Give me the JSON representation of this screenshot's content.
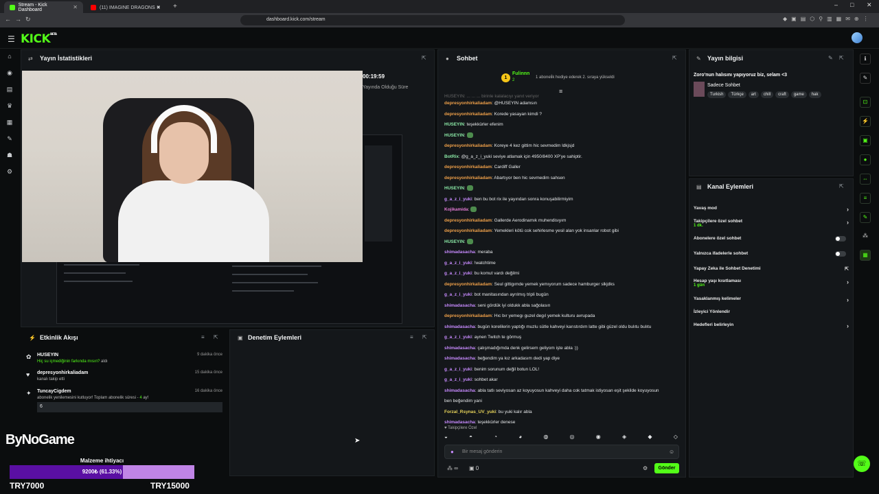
{
  "browser": {
    "tabs": [
      {
        "label": "Stream - Kick Dashboard",
        "active": true
      },
      {
        "label": "(11) IMAGINE DRAGONS ✖ Geo...",
        "active": false
      }
    ],
    "new_tab": "+",
    "url": "dashboard.kick.com/stream"
  },
  "header": {
    "logo": "KICK",
    "logo_badge": "BETA"
  },
  "stats": {
    "title": "Yayın İstatistikleri",
    "duration": "00:19:59",
    "duration_label": "Yayında Olduğu Süre"
  },
  "activity": {
    "title": "Etkinlik Akışı",
    "items": [
      {
        "name": "HUSEYIN",
        "message": "Hiç su içmediğinin farkında mısın?",
        "suffix": "aldı",
        "time": "9 dakika önce"
      },
      {
        "name": "depresyonhirkaliadam",
        "message": "kanalı takip etti",
        "suffix": "",
        "time": "15 dakika önce"
      },
      {
        "name": "TuncayCigdem",
        "message": "abonelik yenilemesini kutluyor! Toplam abonelik süresi -",
        "months": "4",
        "suffix": "ay!",
        "time": "16 dakika önce",
        "note": "6"
      }
    ]
  },
  "moderation": {
    "title": "Denetim Eylemleri"
  },
  "chat": {
    "title": "Sohbet",
    "pinned_user": "Fulinnn",
    "pinned_count": "2",
    "pinned_text": "1 aboneli̇k hediye ederek 2. sıraya yükseldi",
    "top_cut": "HUSEYIN: ... ... ... birinle kalalacıyı yanıt veriyor",
    "messages": [
      {
        "user": "depresyonhirkaliadam",
        "c": "u-or",
        "text": "@HUSEYIN adamsın"
      },
      {
        "user": "depresyonhirkaliadam",
        "c": "u-or",
        "text": "Korede yasayan kimdi ?"
      },
      {
        "user": "HUSEYIN",
        "c": "u-gr",
        "text": "teşekkürler efenim"
      },
      {
        "user": "HUSEYIN",
        "c": "u-gr",
        "text": "",
        "emote": true
      },
      {
        "user": "depresyonhirkaliadam",
        "c": "u-or",
        "text": "Koreye 4 kez gittim hic sevmedim ldkjsjd"
      },
      {
        "user": "BotRix",
        "c": "u-gr",
        "text": "@g_a_z_i_yuki seviye atlamak için 4950/8400 XP'ye sahiptir."
      },
      {
        "user": "depresyonhirkaliadam",
        "c": "u-or",
        "text": "Cardiff Galler"
      },
      {
        "user": "depresyonhirkaliadam",
        "c": "u-or",
        "text": "Abartıyor ben hic sevmedim sahsen"
      },
      {
        "user": "HUSEYIN",
        "c": "u-gr",
        "text": "",
        "emote": true
      },
      {
        "user": "g_a_z_i_yuki",
        "c": "u-pu",
        "text": "ben bu bot rix ile yayından sonra konuşabilirmiyim"
      },
      {
        "user": "Kojikamida",
        "c": "u-pi",
        "text": "",
        "emote": true
      },
      {
        "user": "depresyonhirkaliadam",
        "c": "u-or",
        "text": "Gallerde Aerodinamık muhendisıyım"
      },
      {
        "user": "depresyonhirkaliadam",
        "c": "u-or",
        "text": "Yemekleri kötü cok sehirlesme yesil alan yok insanlar robot gibi"
      },
      {
        "user": "HUSEYIN",
        "c": "u-gr",
        "text": "",
        "emote": true
      },
      {
        "user": "shimadasacha",
        "c": "u-pu",
        "text": "meraba"
      },
      {
        "user": "g_a_z_i_yuki",
        "c": "u-pu",
        "text": "!watchtime"
      },
      {
        "user": "g_a_z_i_yuki",
        "c": "u-pu",
        "text": "bu komut vardı değilmi"
      },
      {
        "user": "depresyonhirkaliadam",
        "c": "u-or",
        "text": "Seul gittigımde yemek yemıyorum sadece hamburger slkjdks"
      },
      {
        "user": "g_a_z_i_yuki",
        "c": "u-pu",
        "text": "bot manitasından ayrılmış tripli bugün"
      },
      {
        "user": "shimadasacha",
        "c": "u-pu",
        "text": "seni gördük iyi oldukk abla sağolasın"
      },
      {
        "user": "depresyonhirkaliadam",
        "c": "u-or",
        "text": "Hıc bır yemegı guzel degıl yemek kulturu avrupada"
      },
      {
        "user": "shimadasacha",
        "c": "u-pu",
        "text": "bugün korelilerin yaptığı muzlu sütle kahveyi karıstırdım latte gibi güzel oldu bulıtu bulıtu"
      },
      {
        "user": "g_a_z_i_yuki",
        "c": "u-pu",
        "text": "aynen Twitch te görmuş"
      },
      {
        "user": "shimadasacha",
        "c": "u-pu",
        "text": "çalışmadığımda denk gelirsem geliyom işte abla :))"
      },
      {
        "user": "shimadasacha",
        "c": "u-pu",
        "text": "beğendim ya kız arkadasım dedi yap diye"
      },
      {
        "user": "g_a_z_i_yuki",
        "c": "u-pu",
        "text": "benim sorunum değil botun LOL!"
      },
      {
        "user": "g_a_z_i_yuki",
        "c": "u-pu",
        "text": "sohbet akar"
      },
      {
        "user": "shimadasacha",
        "c": "u-pu",
        "text": "abla tatlı seviyosan az koyuyosun kahveyi daha cok tatmak istiyosan eşit şekilde koyuyosun"
      },
      {
        "user": "",
        "c": "",
        "text": "ben beğendim yani"
      },
      {
        "user": "Forzal_Rsynas_UV_yuki",
        "c": "u-yl",
        "text": "bu yuki kalır abla"
      },
      {
        "user": "shimadasacha",
        "c": "u-pu",
        "text": "teşekkürler denese"
      }
    ],
    "followers_only": "Takipçilere Özel",
    "input_placeholder": "Bir mesaj gönderin",
    "send": "Gönder",
    "viewers": "∞",
    "count": "0"
  },
  "stream_info": {
    "title": "Yayın bilgisi",
    "stream_title": "Zoro'nun halısını yapıyoruz biz, selam <3",
    "category": "Sadece Sohbet",
    "tags": [
      "Turkish",
      "Türkçe",
      "art",
      "chill",
      "craft",
      "game",
      "hak"
    ]
  },
  "channel_actions": {
    "title": "Kanal Eylemleri",
    "rows": [
      {
        "label": "Yavaş mod",
        "kind": "chev"
      },
      {
        "label": "Takipçilere özel sohbet",
        "sub": "1 dk.",
        "kind": "chev"
      },
      {
        "label": "Abonelere özel sohbet",
        "kind": "toggle"
      },
      {
        "label": "Yalnızca ifadelerle sohbet",
        "kind": "toggle"
      },
      {
        "label": "Yapay Zeka ile Sohbet Denetimi",
        "kind": "ext"
      },
      {
        "label": "Hesap yaşı kısıtlaması",
        "sub": "1 gün",
        "kind": "chev"
      },
      {
        "label": "Yasaklanmış kelimeler",
        "kind": "chev"
      },
      {
        "label": "İzleyici Yönlendir",
        "kind": "none"
      },
      {
        "label": "Hedefleri belirleyin",
        "kind": "chev"
      }
    ]
  },
  "overlay": {
    "brand": "ByNoGame",
    "goal_label": "Malzeme ihtiyacı",
    "goal_text": "9200₺ (61.33%)",
    "goal_fraction": 0.6133,
    "min": "TRY7000",
    "max": "TRY15000"
  },
  "colors": {
    "accent": "#53fc18",
    "goal_fill": "#5a0fa3",
    "goal_bg": "#c084e6"
  }
}
